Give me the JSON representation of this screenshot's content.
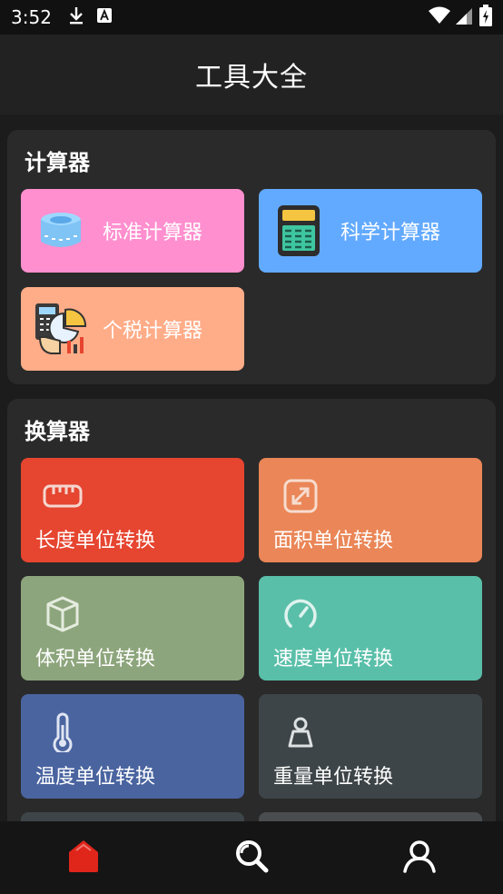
{
  "status_bar": {
    "time": "3:52",
    "icons": [
      "download-icon",
      "a-badge-icon",
      "wifi-icon",
      "signal-icon",
      "battery-icon"
    ]
  },
  "app_bar": {
    "title": "工具大全"
  },
  "calculators": {
    "title": "计算器",
    "items": [
      {
        "label": "标准计算器",
        "color": "#ff8fcf",
        "icon": "tape-measure-icon"
      },
      {
        "label": "科学计算器",
        "color": "#62aaff",
        "icon": "calculator-icon"
      },
      {
        "label": "个税计算器",
        "color": "#ffac88",
        "icon": "tax-calculator-icon"
      }
    ]
  },
  "converters": {
    "title": "换算器",
    "items": [
      {
        "label": "长度单位转换",
        "color": "#e64530",
        "icon": "ruler-icon"
      },
      {
        "label": "面积单位转换",
        "color": "#ea8657",
        "icon": "expand-icon"
      },
      {
        "label": "体积单位转换",
        "color": "#8da57c",
        "icon": "cube-icon"
      },
      {
        "label": "速度单位转换",
        "color": "#5abfa9",
        "icon": "speedometer-icon"
      },
      {
        "label": "温度单位转换",
        "color": "#4a64a0",
        "icon": "thermometer-icon"
      },
      {
        "label": "重量单位转换",
        "color": "#3e4548",
        "icon": "weight-icon"
      }
    ]
  },
  "bottom_nav": {
    "items": [
      {
        "icon": "home-icon",
        "active": true,
        "color": "#e0251b"
      },
      {
        "icon": "search-icon",
        "active": false,
        "color": "#ffffff"
      },
      {
        "icon": "profile-icon",
        "active": false,
        "color": "#ffffff"
      }
    ]
  }
}
